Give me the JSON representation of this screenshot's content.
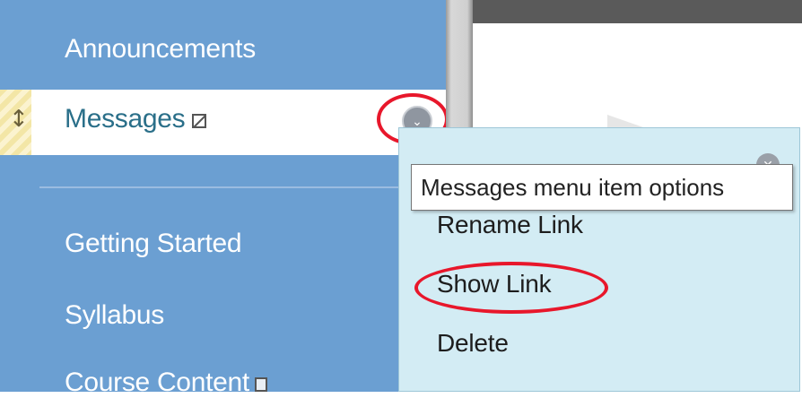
{
  "sidebar": {
    "items": [
      {
        "label": "Announcements"
      },
      {
        "label": "Messages",
        "active": true
      },
      {
        "label": "Getting Started"
      },
      {
        "label": "Syllabus"
      },
      {
        "label": "Course Content"
      }
    ]
  },
  "menu": {
    "tooltip": "Messages menu item options",
    "options": [
      {
        "label": "Rename Link"
      },
      {
        "label": "Show Link"
      },
      {
        "label": "Delete"
      }
    ]
  },
  "icons": {
    "drag": "drag-handle-icon",
    "hidden": "hidden-item-icon",
    "options": "chevron-down-icon",
    "close": "close-icon",
    "content": "content-folder-icon"
  },
  "colors": {
    "sidebar_bg": "#6b9fd2",
    "active_text": "#2a6f89",
    "popup_bg": "#d3ecf4",
    "annotation": "#e8172b"
  }
}
